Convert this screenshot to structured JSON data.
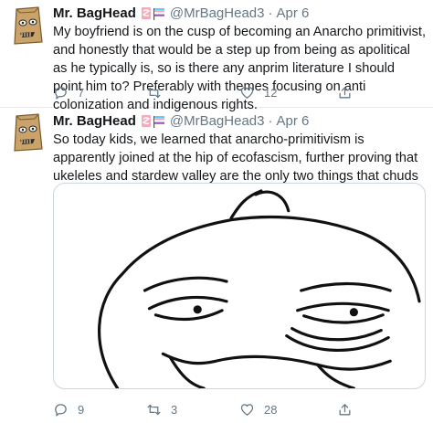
{
  "tweets": [
    {
      "name": "Mr. BagHead",
      "handle": "@MrBagHead3",
      "separator": "·",
      "date": "Apr 6",
      "text": "My boyfriend is on the cusp of becoming an Anarcho primitivist, and honestly that would be a step up from being as apolitical as he typically is, so is there any anprim literature I should point him to? Preferably with themes focusing on anti colonization and indigenous rights.",
      "replies": "7",
      "retweets": "",
      "likes": "12",
      "badge_icons": [
        "fish-cake-emoji-icon",
        "transgender-flag-emoji-icon"
      ]
    },
    {
      "name": "Mr. BagHead",
      "handle": "@MrBagHead3",
      "separator": "·",
      "date": "Apr 6",
      "text": "So today kids, we learned that anarcho-primitivism is apparently joined at the hip of ecofascism, further proving that ukeleles and stardew valley are the only two things that chuds can't ruin.",
      "replies": "9",
      "retweets": "3",
      "likes": "28",
      "badge_icons": [
        "fish-cake-emoji-icon",
        "transgender-flag-emoji-icon"
      ],
      "media": "smug-face-drawing"
    }
  ],
  "icons": {
    "reply": "reply-icon",
    "retweet": "retweet-icon",
    "like": "like-icon",
    "share": "share-icon"
  },
  "colors": {
    "text": "#14171a",
    "secondary": "#657786",
    "divider": "#e6ecf0",
    "avatar_bag": "#c9a36a"
  }
}
